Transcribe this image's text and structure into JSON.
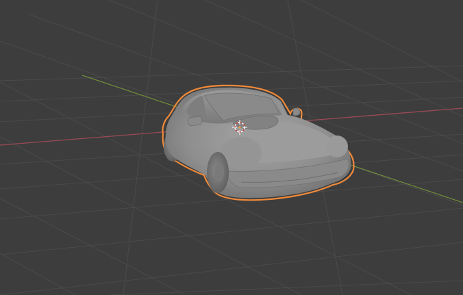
{
  "viewport": {
    "mode": "3d-viewport",
    "shading": "solid",
    "selected_object": "car-model",
    "colors": {
      "background": "#3d3d3d",
      "grid_line": "#4a4a4a",
      "x_axis": "#9a4a56",
      "y_axis": "#6e8a3c",
      "selection_outline": "#f08a3a",
      "mesh": "#8c8c8c"
    },
    "icons": {
      "origin": "3d-cursor-icon"
    }
  }
}
